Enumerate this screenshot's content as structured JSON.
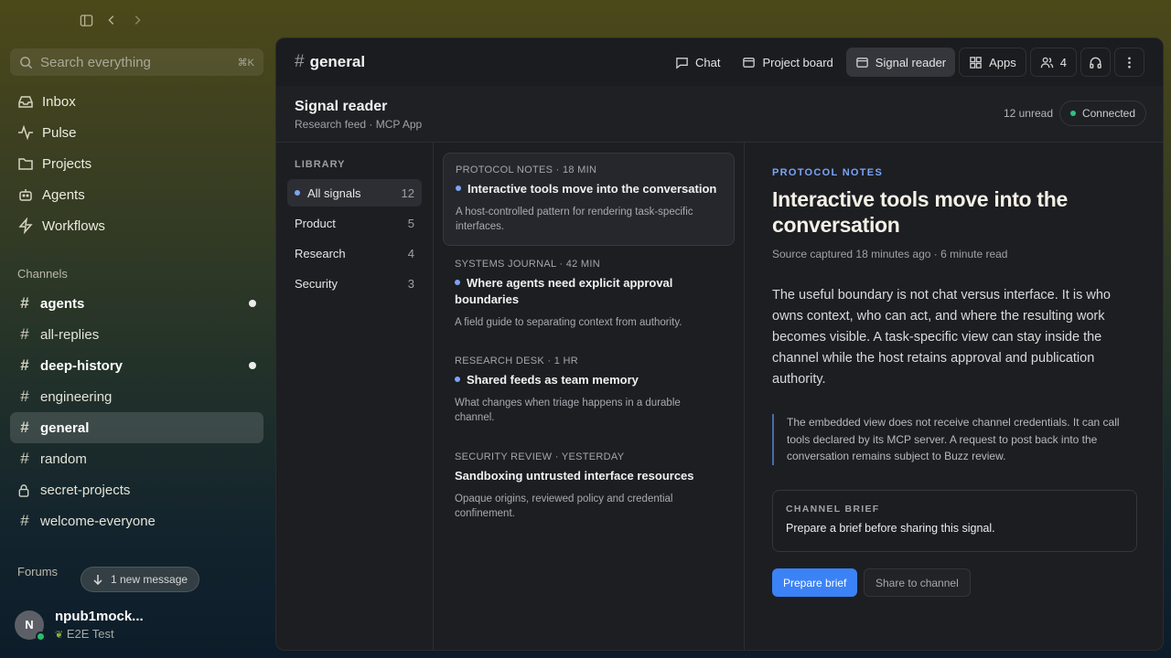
{
  "sidebar": {
    "search_placeholder": "Search everything",
    "search_shortcut": "⌘K",
    "nav": [
      {
        "label": "Inbox",
        "icon": "inbox-icon"
      },
      {
        "label": "Pulse",
        "icon": "pulse-icon"
      },
      {
        "label": "Projects",
        "icon": "folder-icon"
      },
      {
        "label": "Agents",
        "icon": "bot-icon"
      },
      {
        "label": "Workflows",
        "icon": "zap-icon"
      }
    ],
    "channels_label": "Channels",
    "channels": [
      {
        "name": "agents",
        "unread": true
      },
      {
        "name": "all-replies",
        "unread": false
      },
      {
        "name": "deep-history",
        "unread": true
      },
      {
        "name": "engineering",
        "unread": false
      },
      {
        "name": "general",
        "unread": false,
        "active": true
      },
      {
        "name": "random",
        "unread": false
      },
      {
        "name": "secret-projects",
        "unread": false,
        "private": true
      },
      {
        "name": "welcome-everyone",
        "unread": false
      }
    ],
    "forums_label": "Forums",
    "new_message": "1 new message",
    "user": {
      "initial": "N",
      "name": "npub1mock...",
      "status": "E2E Test"
    }
  },
  "header": {
    "channel": "general",
    "tabs": [
      {
        "label": "Chat",
        "icon": "chat-icon"
      },
      {
        "label": "Project board",
        "icon": "board-icon"
      },
      {
        "label": "Signal reader",
        "icon": "reader-icon",
        "active": true
      },
      {
        "label": "Apps",
        "icon": "apps-icon"
      }
    ],
    "members_count": "4"
  },
  "app": {
    "title": "Signal reader",
    "subtitle": "Research feed · MCP App",
    "unread": "12 unread",
    "connection": "Connected"
  },
  "library": {
    "label": "LIBRARY",
    "items": [
      {
        "label": "All signals",
        "count": "12"
      },
      {
        "label": "Product",
        "count": "5"
      },
      {
        "label": "Research",
        "count": "4"
      },
      {
        "label": "Security",
        "count": "3"
      }
    ]
  },
  "feed": [
    {
      "meta": "PROTOCOL NOTES · 18 MIN",
      "title": "Interactive tools move into the conversation",
      "summary": "A host-controlled pattern for rendering task-specific interfaces."
    },
    {
      "meta": "SYSTEMS JOURNAL · 42 MIN",
      "title": "Where agents need explicit approval boundaries",
      "summary": "A field guide to separating context from authority."
    },
    {
      "meta": "RESEARCH DESK · 1 HR",
      "title": "Shared feeds as team memory",
      "summary": "What changes when triage happens in a durable channel."
    },
    {
      "meta": "SECURITY REVIEW · YESTERDAY",
      "title": "Sandboxing untrusted interface resources",
      "summary": "Opaque origins, reviewed policy and credential confinement."
    }
  ],
  "article": {
    "kicker": "PROTOCOL NOTES",
    "title": "Interactive tools move into the conversation",
    "source": "Source captured 18 minutes ago · 6 minute read",
    "body": "The useful boundary is not chat versus interface. It is who owns context, who can act, and where the resulting work becomes visible. A task-specific view can stay inside the channel while the host retains approval and publication authority.",
    "quote": "The embedded view does not receive channel credentials. It can call tools declared by its MCP server. A request to post back into the conversation remains subject to Buzz review.",
    "brief_label": "CHANNEL BRIEF",
    "brief_text": "Prepare a brief before sharing this signal.",
    "primary_button": "Prepare brief",
    "secondary_button": "Share to channel"
  },
  "colors": {
    "accent": "#3b82f6",
    "link_blue": "#7aa4f5",
    "connected": "#2fbf83"
  }
}
